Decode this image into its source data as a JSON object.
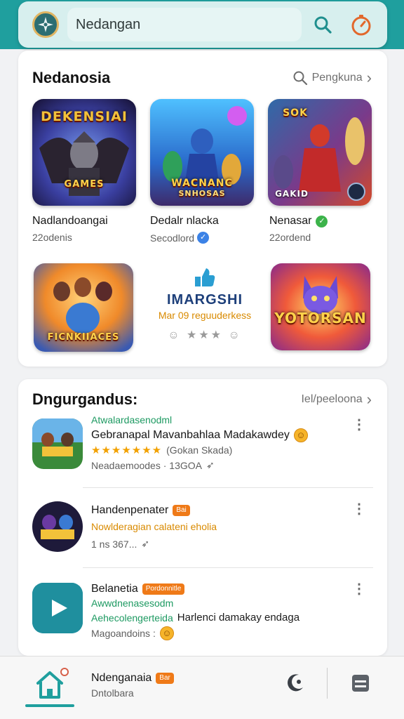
{
  "header": {
    "search_text": "Nedangan",
    "logo_icon": "compass-icon",
    "search_icon": "search-icon",
    "timer_icon": "stopwatch-icon",
    "brand_color": "#1f9f9e"
  },
  "featured": {
    "title": "Nedanosia",
    "see_more": "Pengkuna",
    "games": [
      {
        "art_text_1": "DEKENSIAI",
        "art_text_2": "GAMES",
        "name": "Nadlandoangai",
        "meta": "22odenis"
      },
      {
        "art_text_1": "WACNANC",
        "art_text_2": "SNHOSAS",
        "name": "Dedalr nlacka",
        "meta": "Secodlord",
        "badge": "verified"
      },
      {
        "art_text_1": "SOK",
        "art_text_2": "GAKID",
        "name": "Nenasar",
        "meta": "22ordend",
        "badge": "green"
      },
      {
        "art_text_1": "FICNKIIACES",
        "art_text_2": "",
        "name": "",
        "meta": ""
      },
      {
        "art_text_1": "YOTORSAN",
        "art_text_2": "",
        "name": "",
        "meta": ""
      }
    ],
    "promo": {
      "title": "IMARGSHI",
      "subtitle": "Mar 09 reguuderkess",
      "rating": "★★★"
    }
  },
  "list": {
    "title": "Dngurgandus:",
    "see_more": "Iel/peeloona",
    "items": [
      {
        "category": "Atwalardasenodml",
        "title": "Gebranapal Mavanbahlaa Madakawdey",
        "stars": "★★★★★★★",
        "rating_note": "(Gokan Skada)",
        "meta": "Neadaemoodes · 13GOA"
      },
      {
        "title": "Handenpenater",
        "tag": "Bai",
        "subtitle": "Nowlderagian calateni eholia",
        "meta": "1 ns 367..."
      },
      {
        "title": "Belanetia",
        "tag": "Pordonnitle",
        "category": "Awwdnenasesodm",
        "subtitle": "Aehecolengerteida",
        "subtitle_rest": "Harlenci damakay endaga",
        "meta": "Magoandoins :"
      }
    ]
  },
  "bottom_nav": {
    "title": "Ndenganaia",
    "tag": "Bar",
    "subtitle": "Dntolbara",
    "home_icon": "home-icon",
    "moon_icon": "moon-icon",
    "menu_icon": "menu-icon"
  }
}
